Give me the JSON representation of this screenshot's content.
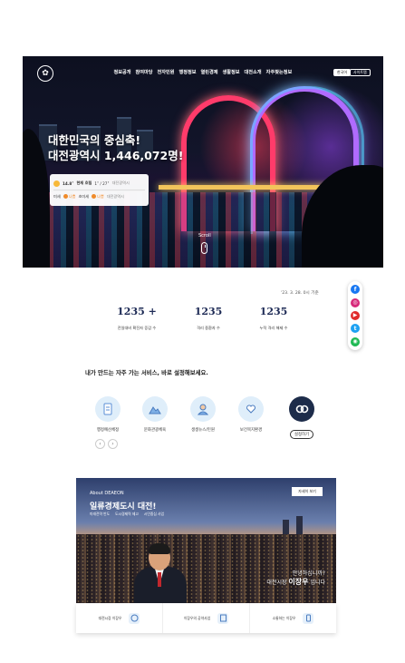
{
  "header": {
    "menu": [
      "정보공개",
      "참여마당",
      "전자민원",
      "행정정보",
      "열린경제",
      "생활정보",
      "대전소개",
      "자주찾는정보"
    ],
    "korean_btn": "한국어",
    "sitemap_btn": "사이트맵"
  },
  "hero": {
    "headline_1": "대한민국의 중심축!",
    "headline_2": "대전광역시 1,446,072명!",
    "weather": {
      "temp": "14.8˚",
      "cond": "현재 흐림",
      "range": "1˚ / 27˚",
      "city": "대전광역시",
      "dust_label": "미세",
      "dust_val": "나쁨",
      "ultra_label": "초미세",
      "ultra_val": "나쁨",
      "city2": "대전광역시"
    },
    "scroll": "Scroll"
  },
  "stats": {
    "date": "'23. 3. 28. 0시 기준",
    "items": [
      {
        "num": "1235 +",
        "label": "전일대비 확진자 증감 수"
      },
      {
        "num": "1235",
        "label": "격리 중환자 수"
      },
      {
        "num": "1235",
        "label": "누적 격리 해제 수"
      }
    ]
  },
  "social": [
    "f",
    "◎",
    "▶",
    "t",
    "◉"
  ],
  "services": {
    "title": "내가 만드는 자주 가는 서비스, 바로 설정해보세요.",
    "items": [
      "행정예산체정",
      "문화관광체육",
      "생생뉴스/민원",
      "보건복지환경",
      "설정하기"
    ],
    "prev": "‹",
    "next": "›"
  },
  "about": {
    "small": "About DEAEON",
    "title": "일류경제도시 대전!",
    "subs": [
      "미래전략 반도",
      "도시경제력 제고",
      "시민중심 사업"
    ],
    "btn": "자세히 보기",
    "greet_1": "안녕하십니까?",
    "greet_2_pre": "대전시장",
    "greet_name": "이장우",
    "greet_2_post": "입니다"
  },
  "links": [
    {
      "label": "대전시장 이장우"
    },
    {
      "label": "이장우의 공약사업"
    },
    {
      "label": "소통하는 이장우"
    }
  ],
  "colors": {
    "navy": "#1d2a55",
    "accent": "#f08b2a"
  }
}
